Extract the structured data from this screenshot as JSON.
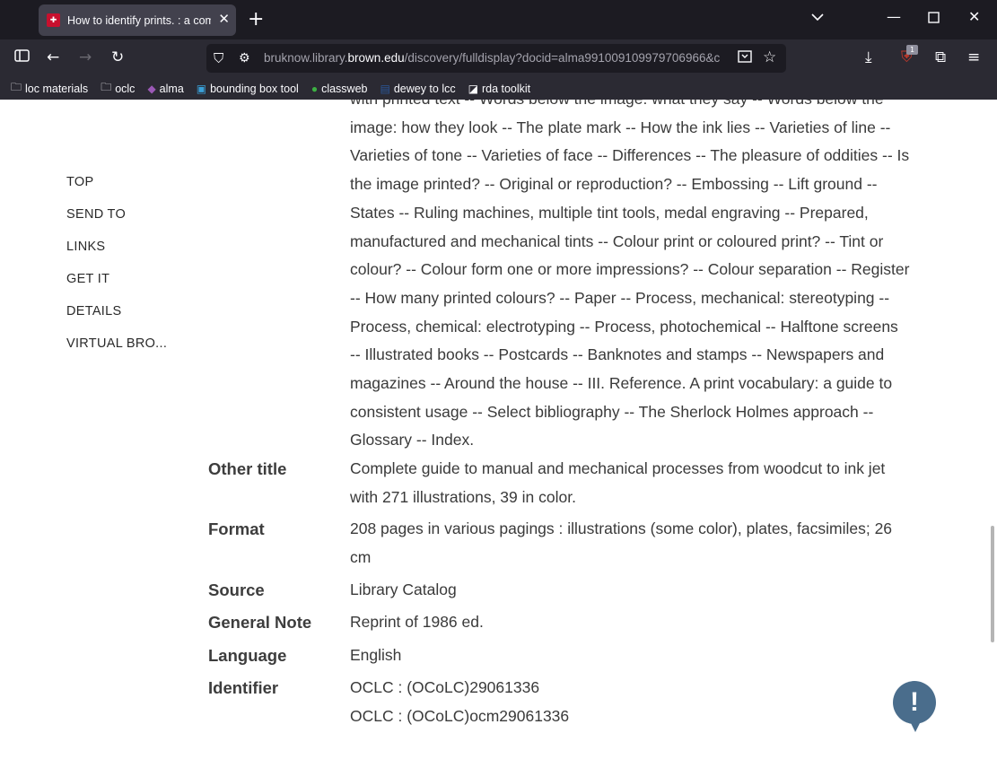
{
  "browser": {
    "tab_title": "How to identify prints. : a comp",
    "url_prefix": "bruknow.library.",
    "url_domain": "brown.edu",
    "url_suffix": "/discovery/fulldisplay?docid=alma991009109979706966&c",
    "extensions_badge": "1",
    "bookmarks": [
      {
        "label": "loc materials",
        "icon": "folder-icon"
      },
      {
        "label": "oclc",
        "icon": "folder-icon"
      },
      {
        "label": "alma",
        "icon": "alma-icon"
      },
      {
        "label": "bounding box tool",
        "icon": "bookmark-icon"
      },
      {
        "label": "classweb",
        "icon": "globe-icon"
      },
      {
        "label": "dewey to lcc",
        "icon": "word-icon"
      },
      {
        "label": "rda toolkit",
        "icon": "rda-icon"
      }
    ]
  },
  "sidenav": [
    "TOP",
    "SEND TO",
    "LINKS",
    "GET IT",
    "DETAILS",
    "VIRTUAL BRO..."
  ],
  "contents_lines": [
    "with printed text -- Words below the image: what they say -- Words below the",
    "image: how they look -- The plate mark -- How the ink lies -- Varieties of line --",
    "Varieties of tone -- Varieties of face -- Differences -- The pleasure of oddities -- Is",
    "the image printed? -- Original or reproduction? -- Embossing -- Lift ground --",
    "States -- Ruling machines, multiple tint tools, medal engraving -- Prepared,",
    "manufactured and mechanical tints -- Colour print or coloured print? -- Tint or",
    "colour? -- Colour form one or more impressions? -- Colour separation -- Register",
    "-- How many printed colours? -- Paper -- Process, mechanical: stereotyping --",
    "Process, chemical: electrotyping -- Process, photochemical -- Halftone screens",
    "-- Illustrated books -- Postcards -- Banknotes and stamps -- Newspapers and",
    "magazines -- Around the house -- III. Reference. A print vocabulary: a guide to",
    "consistent usage -- Select bibliography -- The Sherlock Holmes approach --",
    "Glossary -- Index."
  ],
  "details": [
    {
      "label": "Other title",
      "lines": [
        "Complete guide to manual and mechanical processes from woodcut to ink jet",
        "with 271 illustrations, 39 in color."
      ]
    },
    {
      "label": "Format",
      "lines": [
        "208 pages in various pagings : illustrations (some color), plates, facsimiles; 26",
        "cm"
      ]
    },
    {
      "label": "Source",
      "lines": [
        "Library Catalog"
      ]
    },
    {
      "label": "General Note",
      "lines": [
        "Reprint of 1986 ed."
      ]
    },
    {
      "label": "Language",
      "lines": [
        "English"
      ]
    },
    {
      "label": "Identifier",
      "lines": [
        "OCLC : (OCoLC)29061336",
        "OCLC : (OCoLC)ocm29061336"
      ]
    }
  ],
  "feedback_glyph": "!"
}
